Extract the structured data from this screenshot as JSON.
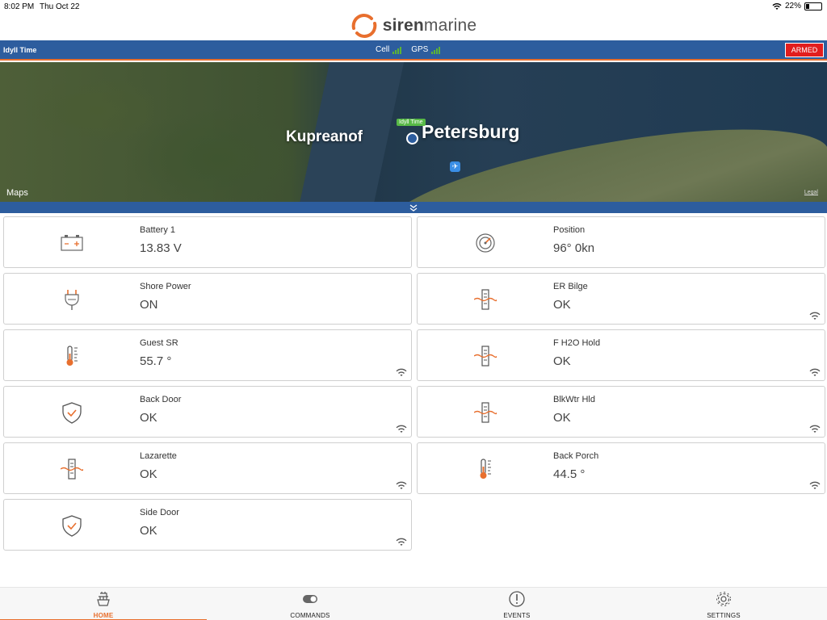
{
  "status_bar": {
    "time": "8:02 PM",
    "date": "Thu Oct 22",
    "battery": "22%",
    "battery_level": 0.22
  },
  "brand": {
    "siren": "siren",
    "marine": "marine",
    "accent": "#e86f2e",
    "primary": "#2d5d9e"
  },
  "header": {
    "vessel_name": "Idyll Time",
    "cell_label": "Cell",
    "gps_label": "GPS",
    "armed_label": "ARMED",
    "armed_color": "#e21d1d"
  },
  "map": {
    "label_kupreanof": "Kupreanof",
    "label_petersburg": "Petersburg",
    "pin_label": "Idyll Time",
    "attribution": "Maps",
    "legal": "Legal"
  },
  "sensors": [
    {
      "name": "Battery 1",
      "value": "13.83 V",
      "icon": "battery-icon",
      "wireless": false
    },
    {
      "name": "Position",
      "value": "96° 0kn",
      "icon": "compass-icon",
      "wireless": false
    },
    {
      "name": "Shore Power",
      "value": "ON",
      "icon": "plug-icon",
      "wireless": false
    },
    {
      "name": "ER Bilge",
      "value": "OK",
      "icon": "water-level-icon",
      "wireless": true
    },
    {
      "name": "Guest SR",
      "value": "55.7 °",
      "icon": "thermometer-icon",
      "wireless": true
    },
    {
      "name": "F H2O Hold",
      "value": "OK",
      "icon": "water-level-icon",
      "wireless": true
    },
    {
      "name": "Back Door",
      "value": "OK",
      "icon": "shield-check-icon",
      "wireless": true
    },
    {
      "name": "BlkWtr Hld",
      "value": "OK",
      "icon": "water-level-icon",
      "wireless": true
    },
    {
      "name": "Lazarette",
      "value": "OK",
      "icon": "water-level-icon",
      "wireless": true
    },
    {
      "name": "Back Porch",
      "value": "44.5 °",
      "icon": "thermometer-icon",
      "wireless": true
    },
    {
      "name": "Side Door",
      "value": "OK",
      "icon": "shield-check-icon",
      "wireless": true
    }
  ],
  "tabs": [
    {
      "label": "HOME",
      "icon": "boat-icon",
      "active": true
    },
    {
      "label": "COMMANDS",
      "icon": "toggle-icon",
      "active": false
    },
    {
      "label": "EVENTS",
      "icon": "alert-icon",
      "active": false
    },
    {
      "label": "SETTINGS",
      "icon": "gear-icon",
      "active": false
    }
  ]
}
